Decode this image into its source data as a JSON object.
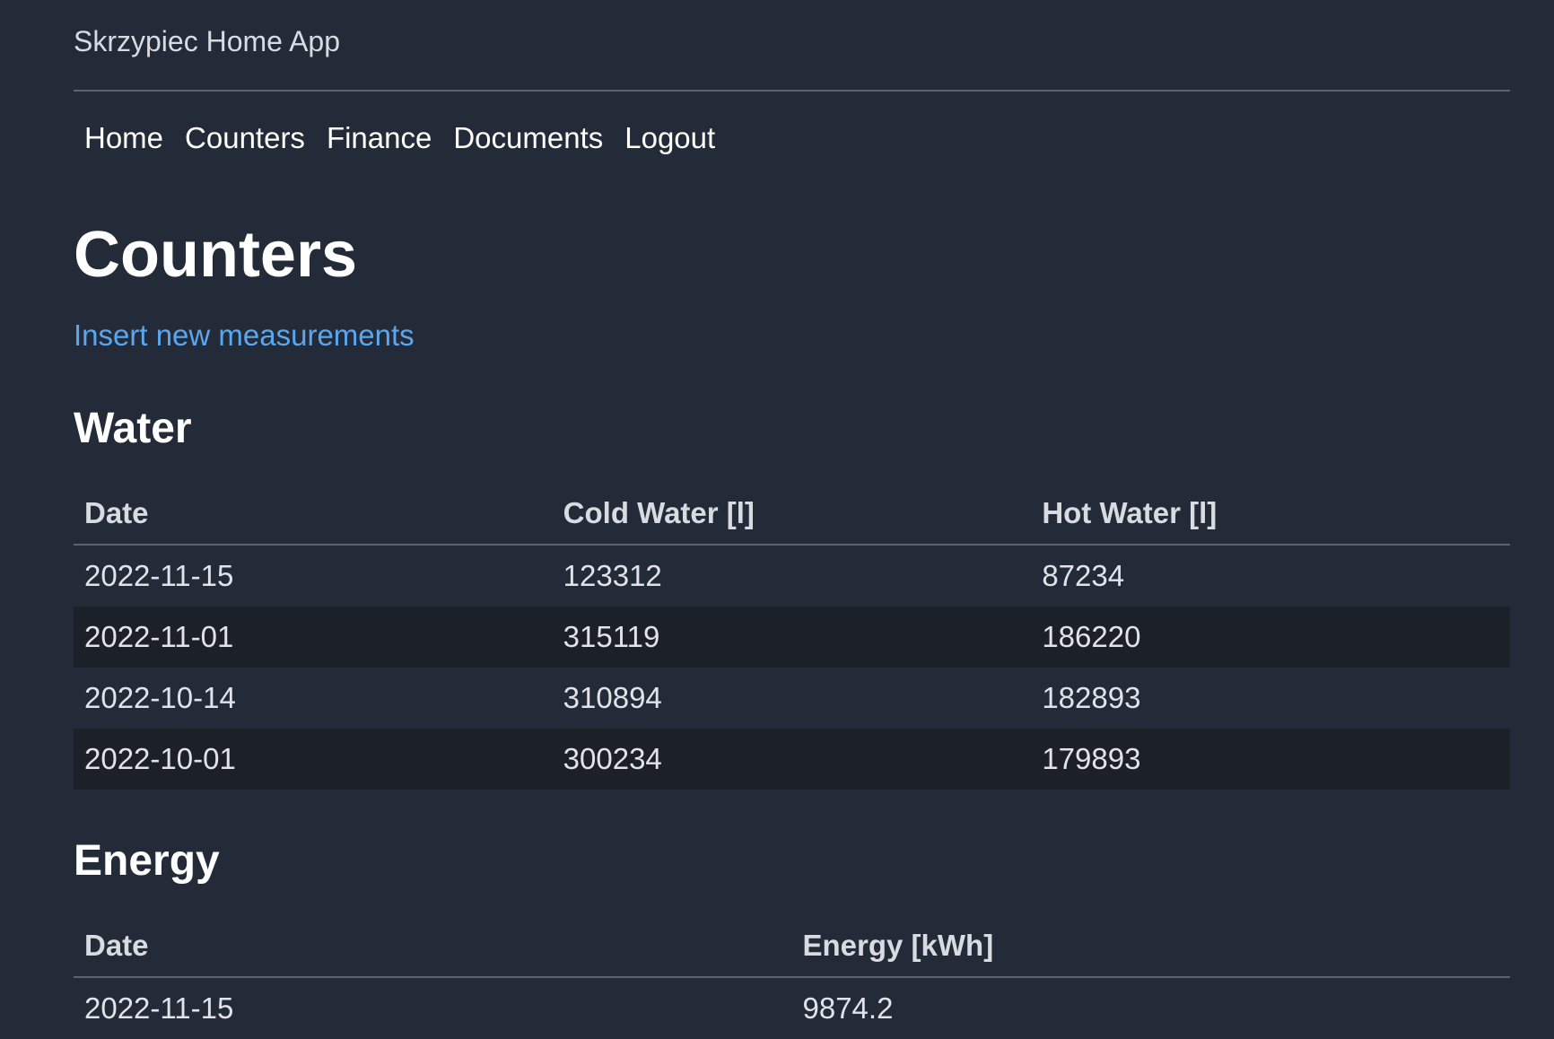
{
  "brand": "Skrzypiec Home App",
  "nav": {
    "items": [
      "Home",
      "Counters",
      "Finance",
      "Documents",
      "Logout"
    ]
  },
  "page_title": "Counters",
  "insert_link": "Insert new measurements",
  "water": {
    "title": "Water",
    "headers": [
      "Date",
      "Cold Water [l]",
      "Hot Water [l]"
    ],
    "rows": [
      [
        "2022-11-15",
        "123312",
        "87234"
      ],
      [
        "2022-11-01",
        "315119",
        "186220"
      ],
      [
        "2022-10-14",
        "310894",
        "182893"
      ],
      [
        "2022-10-01",
        "300234",
        "179893"
      ]
    ]
  },
  "energy": {
    "title": "Energy",
    "headers": [
      "Date",
      "Energy [kWh]"
    ],
    "rows": [
      [
        "2022-11-15",
        "9874.2"
      ]
    ]
  }
}
